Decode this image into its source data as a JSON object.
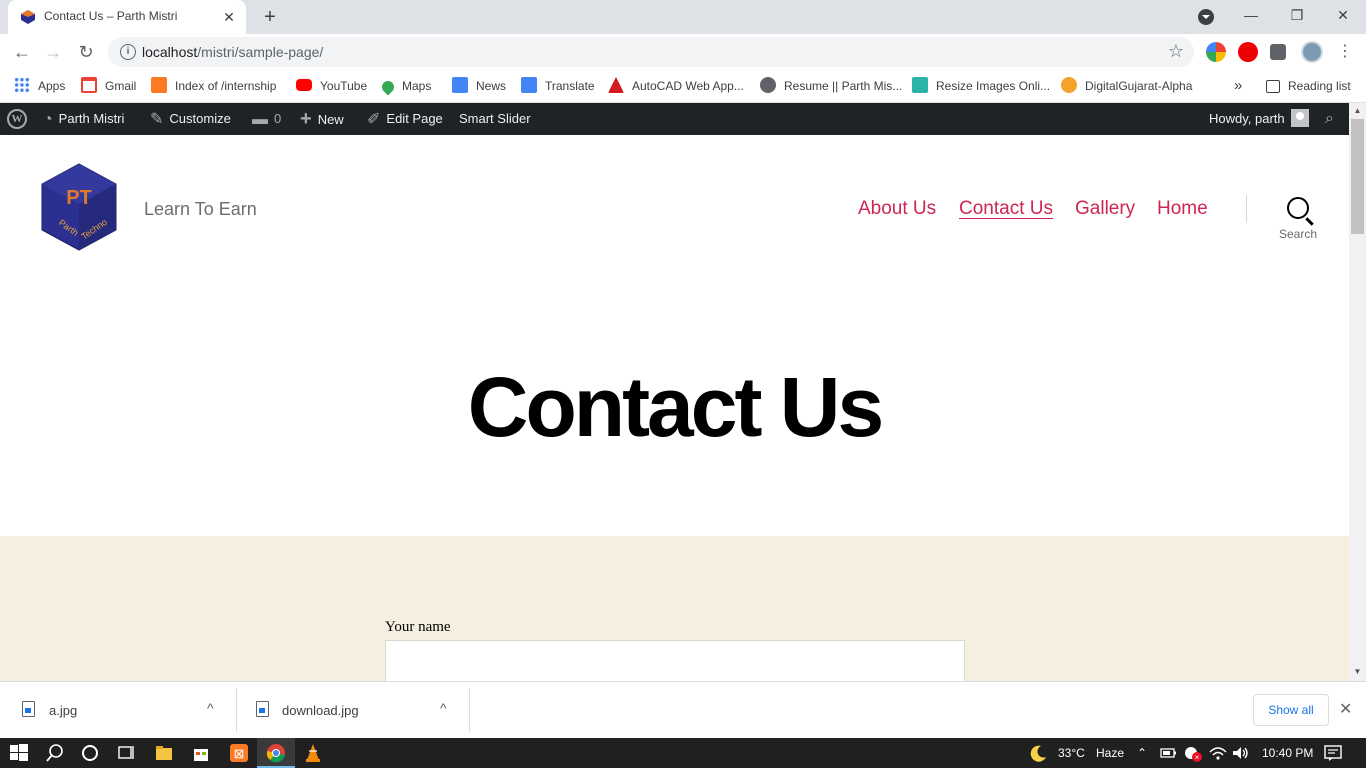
{
  "browser": {
    "tab_title": "Contact Us – Parth Mistri",
    "tab_close": "✕",
    "new_tab": "+",
    "window_controls": {
      "minimize": "—",
      "restore": "❐",
      "close": "✕"
    },
    "url_host": "localhost",
    "url_path": "/mistri/sample-page/",
    "nav": {
      "back": "←",
      "forward": "→",
      "reload": "↻"
    }
  },
  "bookmarks": {
    "items": [
      {
        "label": "Apps",
        "color": "#4285f4"
      },
      {
        "label": "Gmail",
        "color": "#ea4335"
      },
      {
        "label": "Index of /internship",
        "color": "#fb7a24"
      },
      {
        "label": "YouTube",
        "color": "#ff0000"
      },
      {
        "label": "Maps",
        "color": "#34a853"
      },
      {
        "label": "News",
        "color": "#4285f4"
      },
      {
        "label": "Translate",
        "color": "#4285f4"
      },
      {
        "label": "AutoCAD Web App...",
        "color": "#d01c1f"
      },
      {
        "label": "Resume || Parth Mis...",
        "color": "#5f6368"
      },
      {
        "label": "Resize Images Onli...",
        "color": "#2ab3a6"
      },
      {
        "label": "DigitalGujarat-Alpha",
        "color": "#f4a32a"
      }
    ],
    "overflow": "»",
    "reading_list": "Reading list"
  },
  "adminbar": {
    "wp_logo": "W",
    "site_name": "Parth Mistri",
    "customize": "Customize",
    "comments_count": "0",
    "new": "New",
    "edit_page": "Edit Page",
    "smart_slider": "Smart Slider",
    "howdy": "Howdy, parth"
  },
  "site": {
    "logo_text": "PT",
    "logo_sub1": "Parth",
    "logo_sub2": "Techno",
    "tagline": "Learn To Earn",
    "menu": [
      {
        "label": "About Us",
        "current": false
      },
      {
        "label": "Contact Us",
        "current": true
      },
      {
        "label": "Gallery",
        "current": false
      },
      {
        "label": "Home",
        "current": false
      }
    ],
    "search_label": "Search",
    "accent_color": "#cd2653"
  },
  "page": {
    "title": "Contact Us",
    "form": {
      "name_label": "Your name",
      "name_value": ""
    }
  },
  "downloads": {
    "files": [
      {
        "name": "a.jpg"
      },
      {
        "name": "download.jpg"
      }
    ],
    "caret": "^",
    "show_all": "Show all",
    "close": "✕"
  },
  "taskbar": {
    "weather_temp": "33°C",
    "weather_cond": "Haze",
    "time": "10:40 PM"
  }
}
